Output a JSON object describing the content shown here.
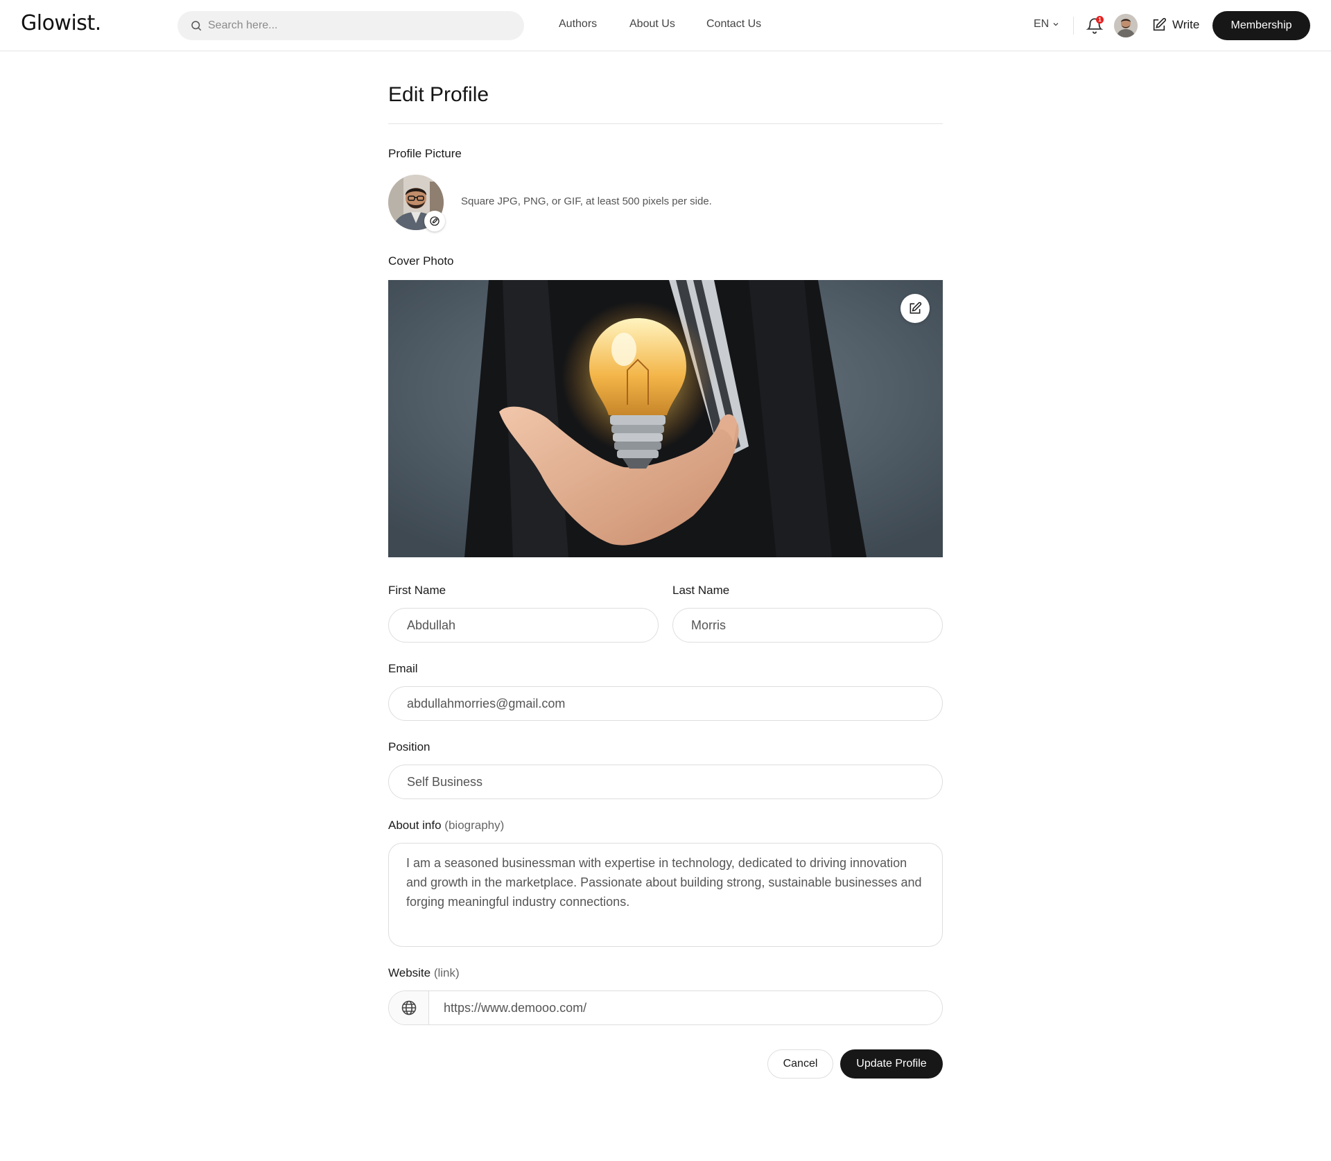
{
  "header": {
    "logo": "Glowist.",
    "search_placeholder": "Search here...",
    "nav": [
      {
        "label": "Authors"
      },
      {
        "label": "About Us"
      },
      {
        "label": "Contact Us"
      }
    ],
    "language": "EN",
    "notification_count": "1",
    "write_label": "Write",
    "membership_label": "Membership"
  },
  "page": {
    "title": "Edit Profile",
    "profile_picture_label": "Profile Picture",
    "profile_picture_hint": "Square JPG, PNG, or GIF, at least 500 pixels per side.",
    "cover_photo_label": "Cover Photo"
  },
  "form": {
    "first_name_label": "First Name",
    "first_name_value": "Abdullah",
    "last_name_label": "Last Name",
    "last_name_value": "Morris",
    "email_label": "Email",
    "email_value": "abdullahmorries@gmail.com",
    "position_label": "Position",
    "position_value": "Self Business",
    "about_label": "About info",
    "about_sub": "(biography)",
    "about_value": "I am a seasoned businessman with expertise in technology, dedicated to driving innovation and growth in the marketplace. Passionate about building strong, sustainable businesses and forging meaningful industry connections.",
    "website_label": "Website",
    "website_sub": "(link)",
    "website_value": "https://www.demooo.com/"
  },
  "actions": {
    "cancel_label": "Cancel",
    "update_label": "Update Profile"
  },
  "icons": {
    "search": "search-icon",
    "language_dropdown": "chevron-down-icon",
    "notifications": "bell-icon",
    "write": "edit-icon",
    "avatar_edit": "camera-edit-icon",
    "cover_edit": "edit-icon",
    "website": "globe-icon"
  },
  "colors": {
    "primary_button": "#171717",
    "notification_badge": "#e52020",
    "cover_background": "#4d5a63"
  }
}
